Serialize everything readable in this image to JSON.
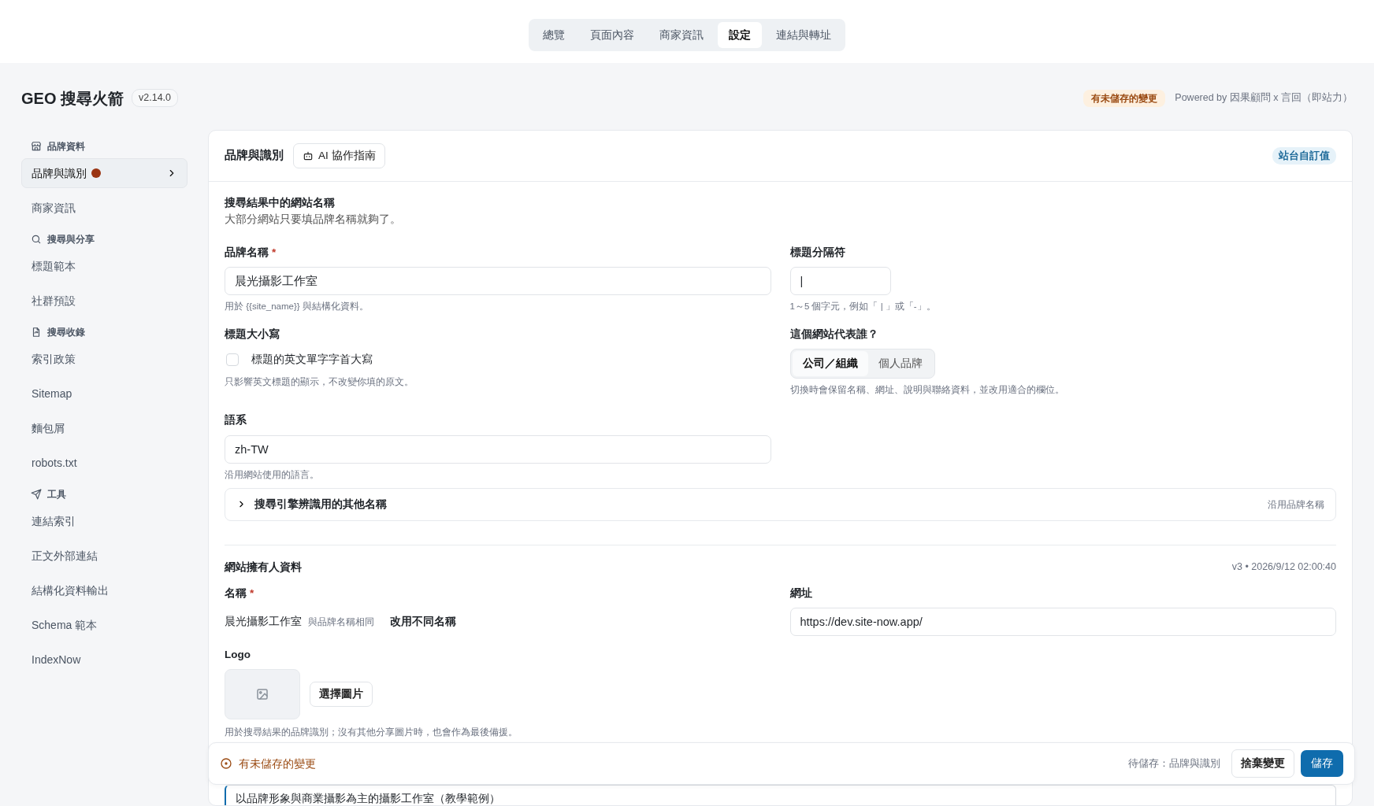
{
  "top_tabs": [
    {
      "label": "總覽",
      "selected": false
    },
    {
      "label": "頁面內容",
      "selected": false
    },
    {
      "label": "商家資訊",
      "selected": false
    },
    {
      "label": "設定",
      "selected": true
    },
    {
      "label": "連結與轉址",
      "selected": false
    }
  ],
  "app": {
    "title": "GEO 搜尋火箭",
    "version": "v2.14.0",
    "unsaved_badge": "有未儲存的變更",
    "powered_by": "Powered by 因果顧問 x 言回（即站力）"
  },
  "sidebar": {
    "groups": [
      {
        "kind": "store",
        "label": "品牌資料",
        "items": [
          {
            "label": "品牌與識別",
            "selected": true,
            "unsaved": true
          },
          {
            "label": "商家資訊",
            "selected": false,
            "unsaved": false
          }
        ]
      },
      {
        "kind": "search",
        "label": "搜尋與分享",
        "items": [
          {
            "label": "標題範本",
            "selected": false,
            "unsaved": false
          },
          {
            "label": "社群預設",
            "selected": false,
            "unsaved": false
          }
        ]
      },
      {
        "kind": "index",
        "label": "搜尋收錄",
        "items": [
          {
            "label": "索引政策",
            "selected": false,
            "unsaved": false
          },
          {
            "label": "Sitemap",
            "selected": false,
            "unsaved": false
          },
          {
            "label": "麵包屑",
            "selected": false,
            "unsaved": false
          },
          {
            "label": "robots.txt",
            "selected": false,
            "unsaved": false
          }
        ]
      },
      {
        "kind": "send",
        "label": "工具",
        "items": [
          {
            "label": "連結索引",
            "selected": false,
            "unsaved": false
          },
          {
            "label": "正文外部連結",
            "selected": false,
            "unsaved": false
          },
          {
            "label": "結構化資料輸出",
            "selected": false,
            "unsaved": false
          },
          {
            "label": "Schema 範本",
            "selected": false,
            "unsaved": false
          },
          {
            "label": "IndexNow",
            "selected": false,
            "unsaved": false
          }
        ]
      }
    ]
  },
  "panel": {
    "title": "品牌與識別",
    "guide_button": "AI 協作指南",
    "badge": "站台自訂值"
  },
  "site_name_section": {
    "title": "搜尋結果中的網站名稱",
    "description": "大部分網站只要填品牌名稱就夠了。",
    "brand_name": {
      "label": "品牌名稱",
      "required_mark": "*",
      "value": "晨光攝影工作室",
      "help": "用於 {{site_name}} 與結構化資料。"
    },
    "separator": {
      "label": "標題分隔符",
      "value": "|",
      "help": "1～5 個字元，例如「 | 」或「-」。"
    },
    "title_case": {
      "label": "標題大小寫",
      "option": "標題的英文單字字首大寫",
      "checked": false,
      "help": "只影響英文標題的顯示，不改變你填的原文。"
    },
    "represents": {
      "label": "這個網站代表誰？",
      "options": [
        {
          "label": "公司／組織",
          "selected": true
        },
        {
          "label": "個人品牌",
          "selected": false
        }
      ],
      "help": "切換時會保留名稱、網址、說明與聯絡資料，並改用適合的欄位。"
    },
    "language": {
      "label": "語系",
      "value": "zh-TW",
      "help": "沿用網站使用的語言。"
    },
    "alternate_names": {
      "label": "搜尋引擎辨識用的其他名稱",
      "expanded": false,
      "status": "沿用品牌名稱"
    }
  },
  "owner_section": {
    "title": "網站擁有人資料",
    "meta": "v3 • 2026/9/12 02:00:40",
    "name": {
      "label": "名稱",
      "required_mark": "*",
      "value": "晨光攝影工作室",
      "note": "與品牌名稱相同",
      "action": "改用不同名稱"
    },
    "url": {
      "label": "網址",
      "value": "https://dev.site-now.app/"
    },
    "logo": {
      "label": "Logo",
      "button": "選擇圖片",
      "help": "用於搜尋結果的品牌識別；沒有其他分享圖片時，也會作為最後備援。"
    },
    "description_value": "以品牌形象與商業攝影為主的攝影工作室（教學範例）"
  },
  "save_bar": {
    "message": "有未儲存的變更",
    "pending": "待儲存：品牌與識別",
    "discard": "捨棄變更",
    "save": "儲存"
  }
}
